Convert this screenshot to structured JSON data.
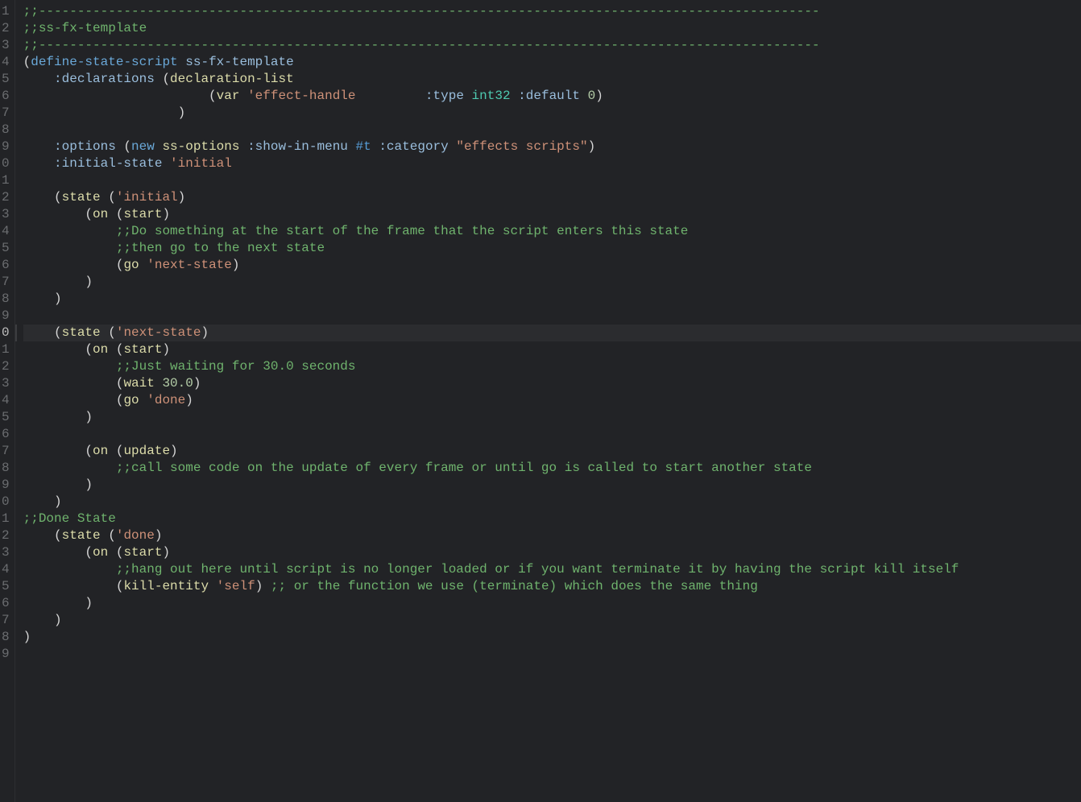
{
  "editor": {
    "start_line_offset": 1,
    "highlight_index": 19,
    "line_count": 39
  },
  "tokens": {
    "comment_dashes": ";;-----------------------------------------------------------------------------------------------------",
    "ss_fx_template_comment": ";;ss-fx-template",
    "define_state_script": "define-state-script",
    "ss_fx_template": "ss-fx-template",
    "declarations": ":declarations",
    "declaration_list": "declaration-list",
    "var": "var",
    "effect_handle": "'effect-handle",
    "type_kw": ":type",
    "int32": "int32",
    "default_kw": ":default",
    "zero": "0",
    "options_kw": ":options",
    "new": "new",
    "ss_options": "ss-options",
    "show_in_menu": ":show-in-menu",
    "true_t": "#t",
    "category_kw": ":category",
    "effects_scripts_str": "\"effects scripts\"",
    "initial_state_kw": ":initial-state",
    "initial_sym": "'initial",
    "state": "state",
    "on": "on",
    "start": "start",
    "comment_start_frame": ";;Do something at the start of the frame that the script enters this state",
    "comment_then_go": ";;then go to the next state",
    "go": "go",
    "next_state_sym": "'next-state",
    "comment_waiting": ";;Just waiting for 30.0 seconds",
    "wait": "wait",
    "thirty": "30.0",
    "done_sym": "'done",
    "update": "update",
    "comment_call_update": ";;call some code on the update of every frame or until go is called to start another state",
    "done_state_comment": ";;Done State",
    "comment_hang": ";;hang out here until script is no longer loaded or if you want terminate it by having the script kill itself",
    "kill_entity": "kill-entity",
    "self_sym": "'self",
    "comment_terminate": ";; or the function we use (terminate) which does the same thing"
  }
}
